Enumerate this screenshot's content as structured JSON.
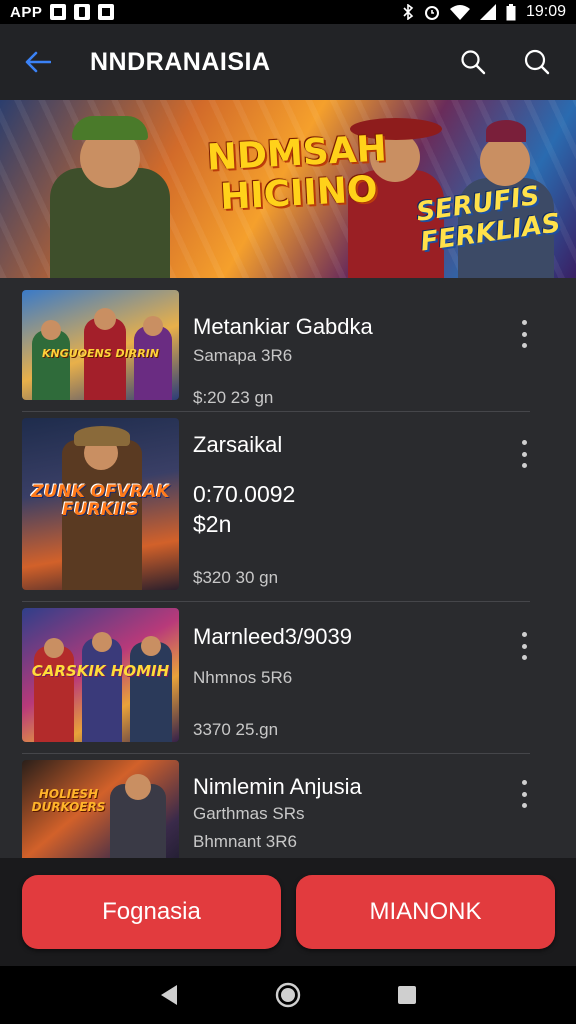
{
  "status_bar": {
    "app_label": "APP",
    "time": "19:09"
  },
  "app_bar": {
    "title": "NNDRANAISIA"
  },
  "banner": {
    "title_line1": "NDMSAH",
    "title_line2": "HICIINO",
    "subtitle_line1": "SERUFIS",
    "subtitle_line2": "FERKLIAS"
  },
  "items": [
    {
      "title": "Metankiar Gabdka",
      "subtitle": "Samapa 3R6",
      "meta": "$:20 23 gn",
      "thumb_logo": "KNGUOENS DIRRIN"
    },
    {
      "title": "Zarsaikal",
      "value_line1": "0:70.0092",
      "value_line2": "$2n",
      "meta": "$320 30 gn",
      "thumb_logo": "ZUNK OFVRAK FURKIIS"
    },
    {
      "title": "Marnleed3/9039",
      "subtitle": "Nhmnos 5R6",
      "meta": "3370 25.gn",
      "thumb_logo": "CARSKIK HOMIH"
    },
    {
      "title": "Nimlemin Anjusia",
      "subtitle": "Garthmas SRs",
      "meta": "Bhmnant 3R6",
      "thumb_logo": "HOLIESH DURKOERS"
    }
  ],
  "buttons": {
    "left": "Fognasia",
    "right": "MIANONK"
  },
  "colors": {
    "accent_red": "#e23b3e",
    "app_bar": "#222326",
    "list_bg": "#2a2b2e",
    "back_arrow": "#3b82f6"
  }
}
